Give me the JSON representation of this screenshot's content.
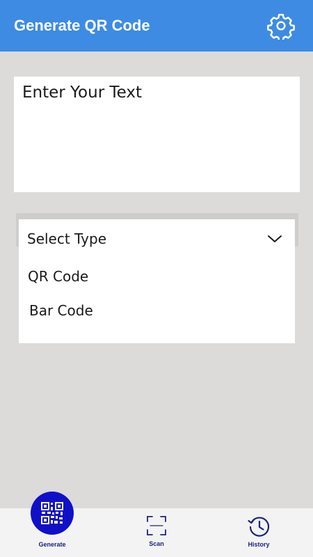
{
  "app_bar": {
    "title": "Generate QR Code",
    "settings_icon": "gear-icon",
    "background": "#3d8be3"
  },
  "text_input": {
    "placeholder": "Enter Your Text",
    "value": ""
  },
  "type_select": {
    "label": "Select Type",
    "expanded": true,
    "options": [
      "QR Code",
      "Bar Code"
    ]
  },
  "bottom_nav": {
    "active": "Generate",
    "accent": "#1010c8",
    "items": [
      {
        "label": "Generate",
        "icon": "qr-code-icon"
      },
      {
        "label": "Scan",
        "icon": "scan-frame-icon"
      },
      {
        "label": "History",
        "icon": "history-icon"
      }
    ]
  }
}
